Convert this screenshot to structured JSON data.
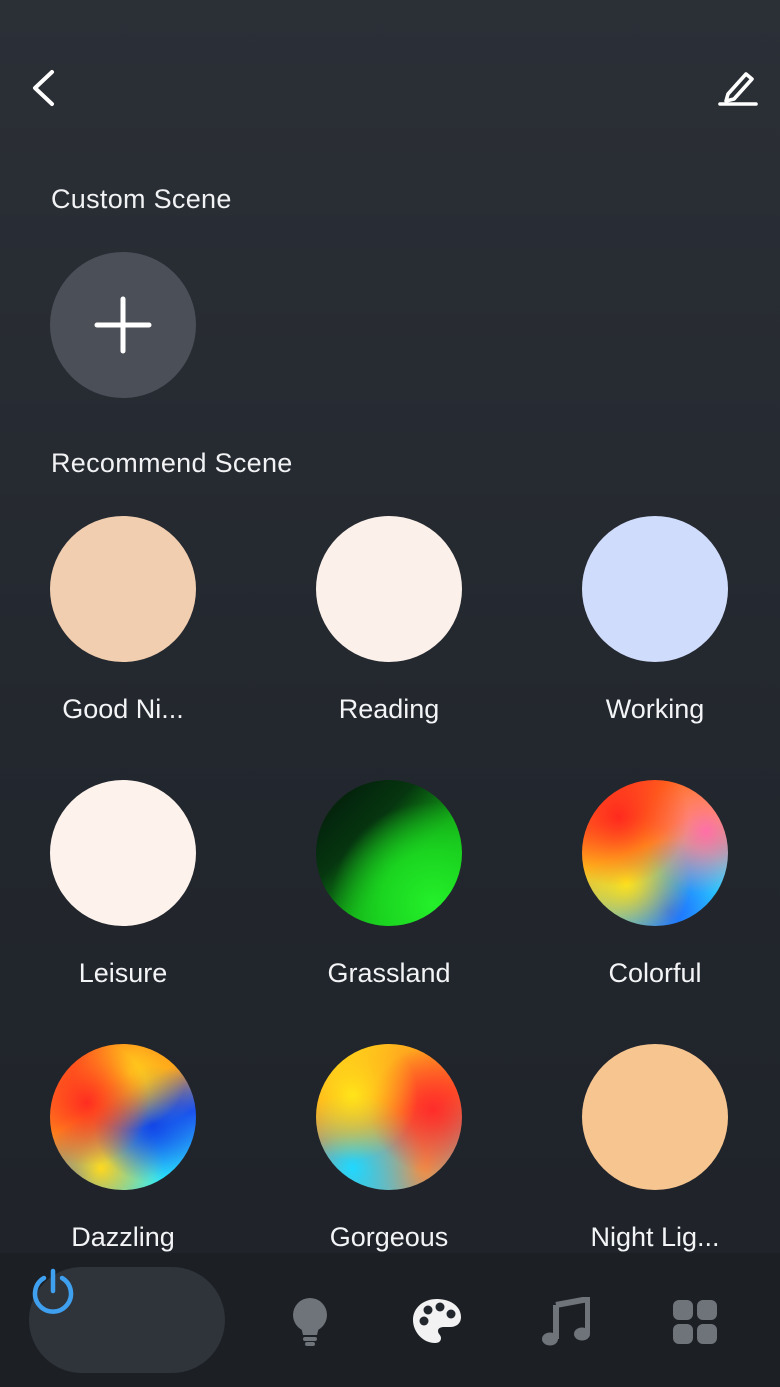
{
  "header": {
    "back_icon": "chevron-left-icon",
    "edit_icon": "pencil-edit-icon"
  },
  "custom": {
    "title": "Custom Scene",
    "add_icon": "plus-icon"
  },
  "recommend": {
    "title": "Recommend Scene",
    "scenes": [
      {
        "label": "Good Ni...",
        "color": "#f2ceb0"
      },
      {
        "label": "Reading",
        "color": "#fcf1ea"
      },
      {
        "label": "Working",
        "color": "#d0dcfb"
      },
      {
        "label": "Leisure",
        "color": "#fdf3ec"
      },
      {
        "label": "Grassland",
        "color": "#1fd024"
      },
      {
        "label": "Colorful",
        "color": "multicolor"
      },
      {
        "label": "Dazzling",
        "color": "multicolor"
      },
      {
        "label": "Gorgeous",
        "color": "multicolor"
      },
      {
        "label": "Night Lig...",
        "color": "#f6c590"
      }
    ]
  },
  "nav": {
    "items": [
      {
        "icon": "power-icon",
        "active": true,
        "color": "#3fa0f0"
      },
      {
        "icon": "bulb-icon",
        "active": false
      },
      {
        "icon": "palette-icon",
        "active": false
      },
      {
        "icon": "music-note-icon",
        "active": false
      },
      {
        "icon": "grid-icon",
        "active": false
      }
    ]
  }
}
